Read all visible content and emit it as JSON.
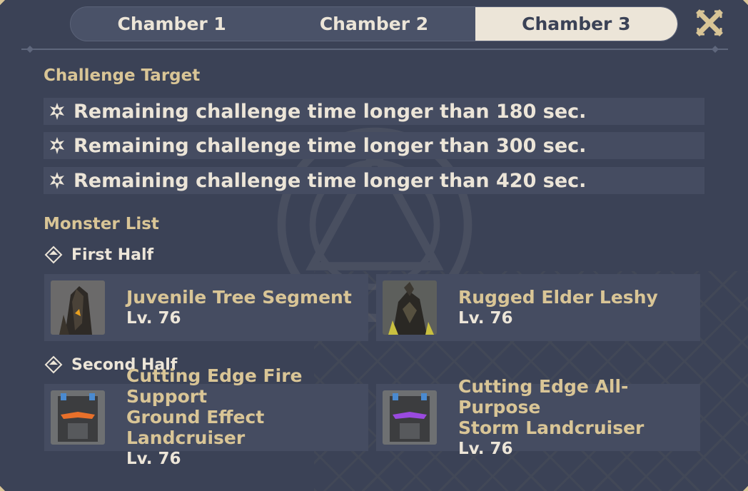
{
  "tabs": [
    {
      "label": "Chamber 1",
      "active": false
    },
    {
      "label": "Chamber 2",
      "active": false
    },
    {
      "label": "Chamber 3",
      "active": true
    }
  ],
  "close_icon": "close-x-icon",
  "challenge": {
    "title": "Challenge Target",
    "icon": "star-emblem-icon",
    "targets": [
      "Remaining challenge time longer than 180 sec.",
      "Remaining challenge time longer than 300 sec.",
      "Remaining challenge time longer than 420 sec."
    ]
  },
  "monsters": {
    "title": "Monster List",
    "first_half": {
      "label": "First Half",
      "items": [
        {
          "name_line1": "Juvenile Tree Segment",
          "name_line2": "",
          "level": "Lv. 76"
        },
        {
          "name_line1": "Rugged Elder Leshy",
          "name_line2": "",
          "level": "Lv. 76"
        }
      ]
    },
    "second_half": {
      "label": "Second Half",
      "items": [
        {
          "name_line1": "Cutting Edge Fire Support",
          "name_line2": "Ground Effect Landcruiser",
          "level": "Lv. 76"
        },
        {
          "name_line1": "Cutting Edge All-Purpose",
          "name_line2": "Storm Landcruiser",
          "level": "Lv. 76"
        }
      ]
    }
  },
  "colors": {
    "background": "#3b4256",
    "accent_gold": "#d9c596",
    "text_light": "#ece5d8",
    "row_background": "#454c61"
  }
}
